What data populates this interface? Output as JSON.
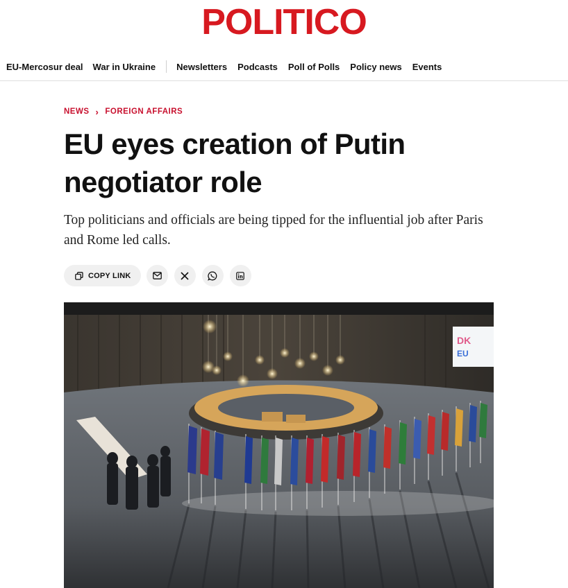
{
  "site": {
    "logo": "POLITICO",
    "brand_color": "#d71920"
  },
  "nav": {
    "items": [
      {
        "label": "EU-Mercosur deal"
      },
      {
        "label": "War in Ukraine"
      },
      {
        "label": "Newsletters"
      },
      {
        "label": "Podcasts"
      },
      {
        "label": "Poll of Polls"
      },
      {
        "label": "Policy news"
      },
      {
        "label": "Events"
      }
    ]
  },
  "breadcrumb": {
    "section": "NEWS",
    "subsection": "FOREIGN AFFAIRS",
    "color": "#c8102e"
  },
  "article": {
    "headline": "EU eyes creation of Putin negotiator role",
    "dek": "Top politicians and officials are being tipped for the influential job after Paris and Rome led calls."
  },
  "share": {
    "copy_link_label": "COPY LINK",
    "icons": [
      "email-icon",
      "x-icon",
      "whatsapp-icon",
      "linkedin-icon"
    ]
  },
  "hero_image": {
    "screen_text": [
      "DK",
      "EU"
    ]
  }
}
